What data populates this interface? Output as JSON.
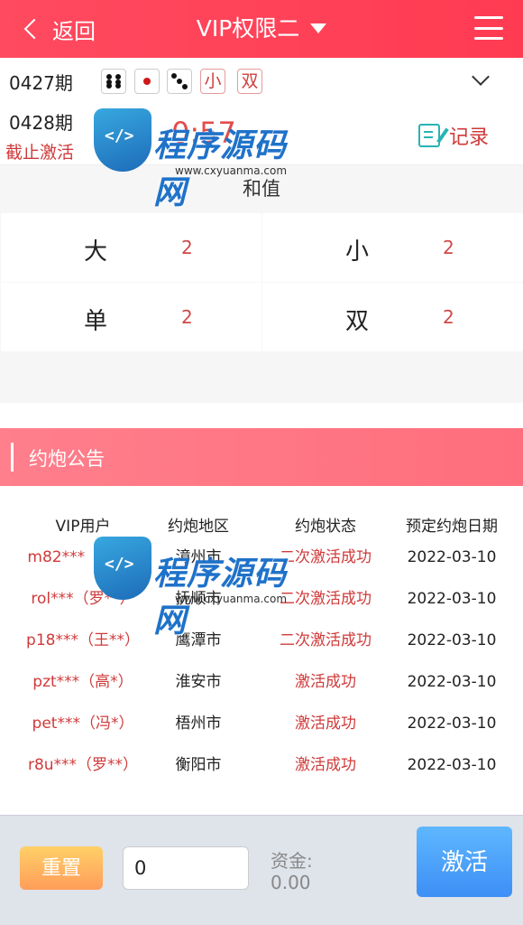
{
  "header": {
    "back_label": "返回",
    "title": "VIP权限二"
  },
  "last_period": {
    "number": "0427期",
    "dice": [
      4,
      1,
      3
    ],
    "tags": [
      "小",
      "双"
    ]
  },
  "current_period": {
    "number": "0428期",
    "status": "截止激活",
    "countdown": "0:57",
    "record_label": "记录"
  },
  "bet_panel": {
    "sum_label": "和值",
    "options": [
      {
        "name": "大",
        "odds": "2"
      },
      {
        "name": "小",
        "odds": "2"
      },
      {
        "name": "单",
        "odds": "2"
      },
      {
        "name": "双",
        "odds": "2"
      }
    ]
  },
  "notice": {
    "title": "约炮公告",
    "columns": [
      "VIP用户",
      "约炮地区",
      "约炮状态",
      "预定约炮日期"
    ],
    "rows": [
      {
        "user": "m82***（白*）",
        "region": "漳州市",
        "status": "二次激活成功",
        "date": "2022-03-10"
      },
      {
        "user": "rol***（罗**）",
        "region": "抚顺市",
        "status": "二次激活成功",
        "date": "2022-03-10"
      },
      {
        "user": "p18***（王**）",
        "region": "鹰潭市",
        "status": "二次激活成功",
        "date": "2022-03-10"
      },
      {
        "user": "pzt***（高*）",
        "region": "淮安市",
        "status": "激活成功",
        "date": "2022-03-10"
      },
      {
        "user": "pet***（冯*）",
        "region": "梧州市",
        "status": "激活成功",
        "date": "2022-03-10"
      },
      {
        "user": "r8u***（罗**）",
        "region": "衡阳市",
        "status": "激活成功",
        "date": "2022-03-10"
      }
    ]
  },
  "watermark": {
    "brand": "程序源码网",
    "url": "www.cxyuanma.com"
  },
  "bottom": {
    "reset_label": "重置",
    "amount_value": "0",
    "fund_label": "资金:",
    "fund_value": "0.00",
    "activate_label": "激活"
  },
  "colors": {
    "header_red": "#ff3b52",
    "notice_pink": "#ff7585",
    "accent_red": "#d03a3a",
    "activate_blue": "#3d8ff5",
    "reset_orange": "#ffb05f"
  }
}
